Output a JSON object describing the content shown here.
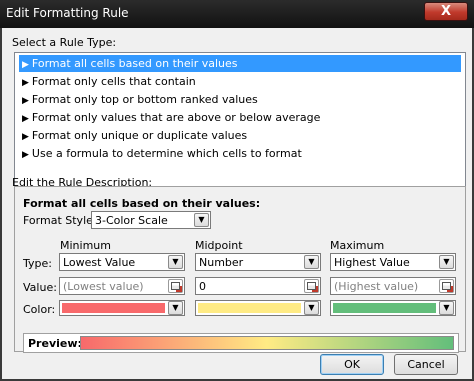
{
  "window": {
    "title": "Edit Formatting Rule",
    "close_symbol": "X"
  },
  "rule_type": {
    "label": "Select a Rule Type:",
    "items": [
      "Format all cells based on their values",
      "Format only cells that contain",
      "Format only top or bottom ranked values",
      "Format only values that are above or below average",
      "Format only unique or duplicate values",
      "Use a formula to determine which cells to format"
    ],
    "selected_index": 0,
    "arrow_symbol": "▶"
  },
  "description": {
    "label": "Edit the Rule Description:",
    "heading": "Format all cells based on their values:",
    "format_style": {
      "label": "Format Style:",
      "value": "3-Color Scale"
    },
    "row_labels": {
      "type": "Type:",
      "value": "Value:",
      "color": "Color:"
    },
    "columns": [
      {
        "header": "Minimum",
        "type": "Lowest Value",
        "value": "(Lowest value)",
        "value_is_placeholder": true,
        "color": "#f8696b"
      },
      {
        "header": "Midpoint",
        "type": "Number",
        "value": "0",
        "value_is_placeholder": false,
        "color": "#ffeb84"
      },
      {
        "header": "Maximum",
        "type": "Highest Value",
        "value": "(Highest value)",
        "value_is_placeholder": true,
        "color": "#63be7b"
      }
    ],
    "preview_label": "Preview:"
  },
  "buttons": {
    "ok": "OK",
    "cancel": "Cancel"
  },
  "dropdown_symbol": "▼"
}
